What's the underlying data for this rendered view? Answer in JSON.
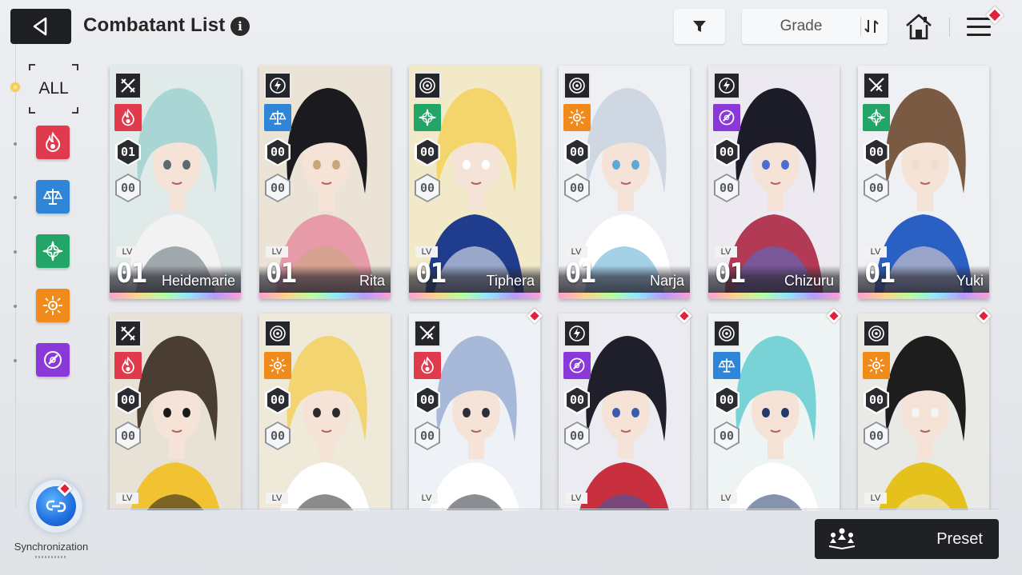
{
  "header": {
    "title": "Combatant List",
    "info_icon": "i",
    "grade_label": "Grade"
  },
  "sidebar": {
    "all_label": "ALL",
    "elements": [
      {
        "name": "fire-element-icon",
        "color": "#e23a4d"
      },
      {
        "name": "balance-element-icon",
        "color": "#2f86d9"
      },
      {
        "name": "star-element-icon",
        "color": "#22a566"
      },
      {
        "name": "sun-element-icon",
        "color": "#f08a1a"
      },
      {
        "name": "void-element-icon",
        "color": "#8a38d8"
      }
    ],
    "sync_label": "Synchronization"
  },
  "cards": [
    {
      "name": "Heidemarie",
      "class": "blades",
      "element": "fire",
      "badge1": "01",
      "badge2": "00",
      "lv_label": "LV",
      "level": "01",
      "new": false
    },
    {
      "name": "Rita",
      "class": "lightning",
      "element": "balance",
      "badge1": "00",
      "badge2": "00",
      "lv_label": "LV",
      "level": "01",
      "new": false
    },
    {
      "name": "Tiphera",
      "class": "target",
      "element": "star",
      "badge1": "00",
      "badge2": "00",
      "lv_label": "LV",
      "level": "01",
      "new": false
    },
    {
      "name": "Narja",
      "class": "target",
      "element": "sun",
      "badge1": "00",
      "badge2": "00",
      "lv_label": "LV",
      "level": "01",
      "new": false
    },
    {
      "name": "Chizuru",
      "class": "lightning",
      "element": "void",
      "badge1": "00",
      "badge2": "00",
      "lv_label": "LV",
      "level": "01",
      "new": false
    },
    {
      "name": "Yuki",
      "class": "swords",
      "element": "star",
      "badge1": "00",
      "badge2": "00",
      "lv_label": "LV",
      "level": "01",
      "new": false
    },
    {
      "name": "",
      "class": "blades",
      "element": "fire",
      "badge1": "00",
      "badge2": "00",
      "lv_label": "LV",
      "level": "",
      "new": false
    },
    {
      "name": "",
      "class": "target",
      "element": "sun",
      "badge1": "00",
      "badge2": "00",
      "lv_label": "LV",
      "level": "",
      "new": false
    },
    {
      "name": "",
      "class": "swords",
      "element": "fire",
      "badge1": "00",
      "badge2": "00",
      "lv_label": "LV",
      "level": "",
      "new": true
    },
    {
      "name": "",
      "class": "lightning",
      "element": "void",
      "badge1": "00",
      "badge2": "00",
      "lv_label": "LV",
      "level": "",
      "new": true
    },
    {
      "name": "",
      "class": "target",
      "element": "balance",
      "badge1": "00",
      "badge2": "00",
      "lv_label": "LV",
      "level": "",
      "new": true
    },
    {
      "name": "",
      "class": "target",
      "element": "sun",
      "badge1": "00",
      "badge2": "00",
      "lv_label": "LV",
      "level": "",
      "new": true
    }
  ],
  "footer": {
    "preset_label": "Preset"
  },
  "colors": {
    "accent_red": "#e0223a",
    "dark_button": "#1d1f22",
    "fire": "#e23a4d",
    "balance": "#2f86d9",
    "star": "#22a566",
    "sun": "#f08a1a",
    "void": "#8a38d8"
  }
}
